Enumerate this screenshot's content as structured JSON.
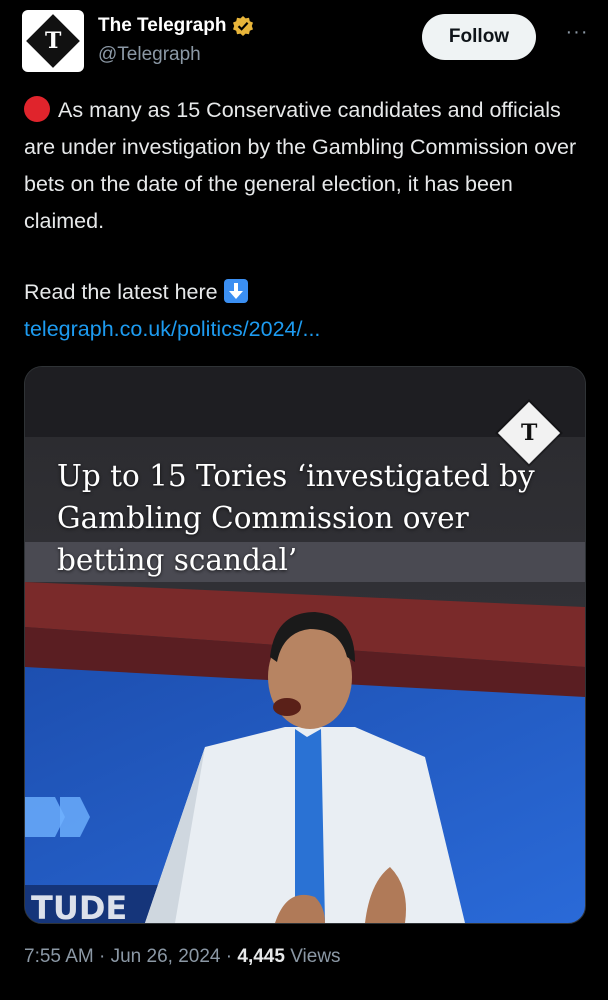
{
  "account": {
    "display_name": "The Telegraph",
    "handle": "@Telegraph",
    "avatar_letter": "T",
    "verified": true,
    "verified_color": "#e8b53a"
  },
  "actions": {
    "follow_label": "Follow",
    "more_icon": "more-horizontal-icon"
  },
  "tweet": {
    "text": "As many as 15 Conservative candidates and officials are under investigation by the Gambling Commission over bets on the date of the general election, it has been claimed.",
    "read_more": "Read the latest here",
    "link": "telegraph.co.uk/politics/2024/..."
  },
  "media": {
    "headline": "Up to 15 Tories ‘investigated by Gambling Commission over betting scandal’",
    "logo_letter": "T",
    "partial_backdrop_text": "TUDE"
  },
  "meta": {
    "time": "7:55 AM",
    "date": "Jun 26, 2024",
    "views_count": "4,445",
    "views_label": "Views"
  },
  "colors": {
    "link": "#1d9bf0",
    "alert_dot": "#e0242c",
    "background": "#000000"
  }
}
